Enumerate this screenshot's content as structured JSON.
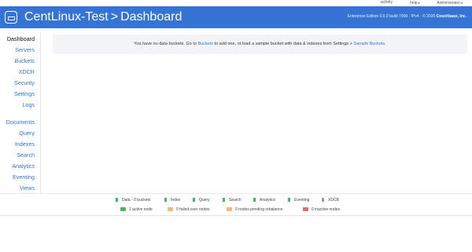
{
  "top_nav": {
    "activity": "activity",
    "help": "help",
    "user": "Administrator"
  },
  "header": {
    "cluster": "CentLinux-Test",
    "separator": ">",
    "page": "Dashboard",
    "edition_text": "Enterprise Edition 6.6.0 build 7909 · IPv4 · © 2020",
    "company": "Couchbase, Inc.",
    "brand_color": "#3574d4"
  },
  "sidebar": {
    "items": [
      {
        "label": "Dashboard",
        "active": true
      },
      {
        "label": "Servers"
      },
      {
        "label": "Buckets"
      },
      {
        "label": "XDCR"
      },
      {
        "label": "Security"
      },
      {
        "label": "Settings"
      },
      {
        "label": "Logs"
      },
      {
        "label": "Documents"
      },
      {
        "label": "Query"
      },
      {
        "label": "Indexes"
      },
      {
        "label": "Search"
      },
      {
        "label": "Analytics"
      },
      {
        "label": "Eventing"
      },
      {
        "label": "Views"
      }
    ]
  },
  "alert": {
    "part1": "You have no data buckets. Go to ",
    "link1": "Buckets",
    "part2": " to add one, or load a sample bucket with data & indexes from Settings > ",
    "link2": "Sample Buckets",
    "part3": "."
  },
  "services": [
    {
      "label": "Data - 0 buckets",
      "color": "#3dbd5f"
    },
    {
      "label": "Index",
      "color": "#3dbd5f"
    },
    {
      "label": "Query",
      "color": "#3dbd5f"
    },
    {
      "label": "Search",
      "color": "#3dbd5f"
    },
    {
      "label": "Analytics",
      "color": "#3dbd5f"
    },
    {
      "label": "Eventing",
      "color": "#3dbd5f"
    },
    {
      "label": "XDCR",
      "color": "#9a9a9a"
    }
  ],
  "node_stats": [
    {
      "label": "1 active node",
      "color": "#3dbd5f"
    },
    {
      "label": "0 failed-over nodes",
      "color": "#f0b97a"
    },
    {
      "label": "0 nodes pending rebalance",
      "color": "#f0b97a"
    },
    {
      "label": "0 inactive nodes",
      "color": "#e06b6b"
    }
  ]
}
